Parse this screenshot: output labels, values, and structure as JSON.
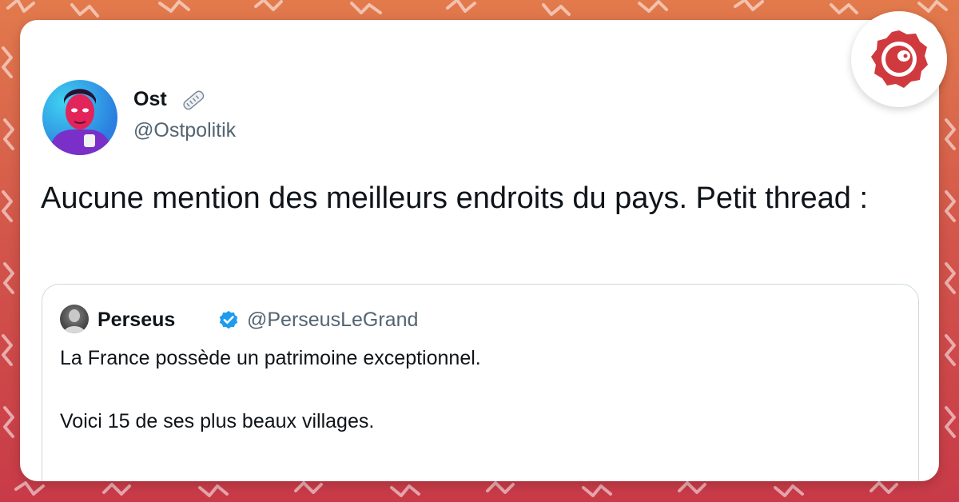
{
  "tweet": {
    "author_name": "Ost",
    "author_handle": "@Ostpolitik",
    "text": "Aucune mention des meilleurs endroits du pays. Petit thread :",
    "name_badge_icon": "newspaper-icon"
  },
  "quoted_tweet": {
    "author_name": "Perseus",
    "author_handle": "@PerseusLeGrand",
    "verified": true,
    "line1": "La France possède un patrimoine exceptionnel.",
    "line2": "Voici 15 de ses plus beaux villages."
  },
  "branding": {
    "icon": "brand-logo-icon",
    "color": "#d03a3f"
  },
  "colors": {
    "text": "#0f1419",
    "muted": "#536471",
    "verified": "#1d9bf0"
  }
}
